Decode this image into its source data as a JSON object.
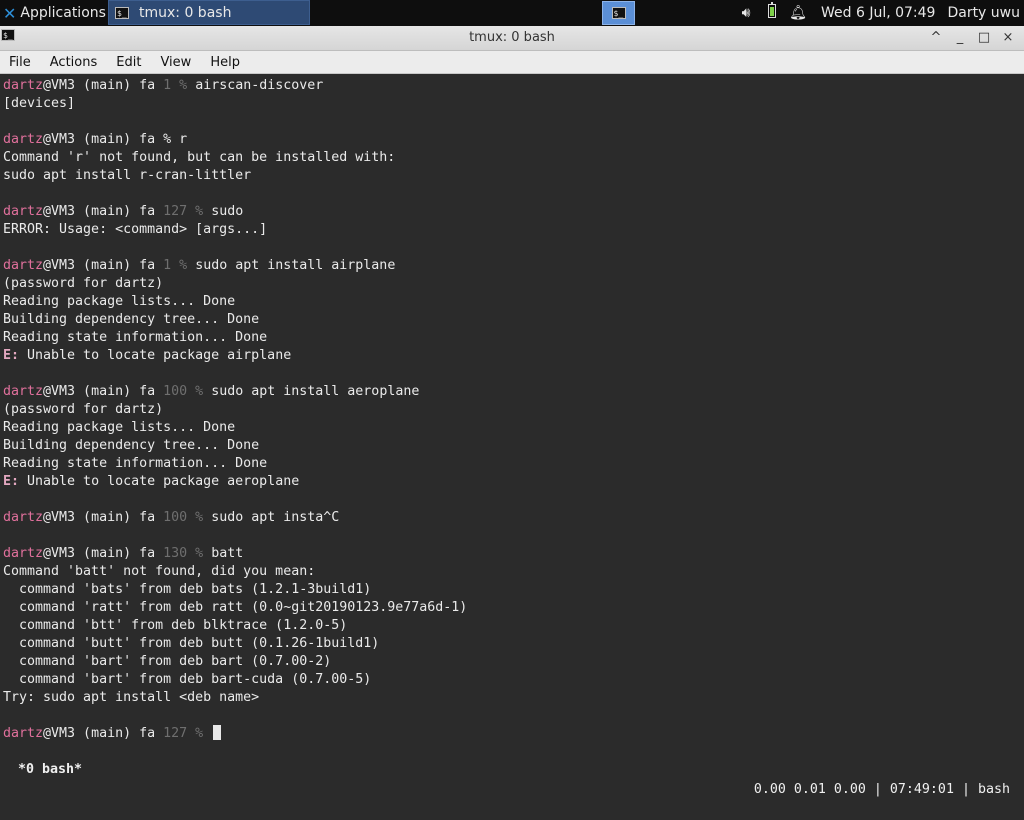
{
  "panel": {
    "applications_label": "Applications",
    "task_label": "tmux: 0 bash",
    "clock": "Wed  6 Jul, 07:49",
    "user": "Darty uwu",
    "icons": [
      "xfce-logo-icon",
      "terminal-icon",
      "volume-icon",
      "battery-icon",
      "notification-bell-icon"
    ]
  },
  "window": {
    "title": "tmux: 0 bash",
    "buttons": [
      "^",
      "_",
      "□",
      "×"
    ]
  },
  "menu": {
    "items": [
      "File",
      "Actions",
      "Edit",
      "View",
      "Help"
    ]
  },
  "terminal": {
    "lines": [
      {
        "type": "prompt",
        "user": "dartz",
        "host": "@VM3 (main) fa",
        "code": "1",
        "cmd": "airscan-discover"
      },
      {
        "type": "out",
        "text": "[devices]"
      },
      {
        "type": "blank"
      },
      {
        "type": "prompt",
        "user": "dartz",
        "host": "@VM3 (main) fa",
        "code": "",
        "cmd": "r"
      },
      {
        "type": "out",
        "text": "Command 'r' not found, but can be installed with:"
      },
      {
        "type": "out",
        "text": "sudo apt install r-cran-littler"
      },
      {
        "type": "blank"
      },
      {
        "type": "prompt",
        "user": "dartz",
        "host": "@VM3 (main) fa",
        "code": "127",
        "cmd": "sudo"
      },
      {
        "type": "out",
        "text": "ERROR: Usage: <command> [args...]"
      },
      {
        "type": "blank"
      },
      {
        "type": "prompt",
        "user": "dartz",
        "host": "@VM3 (main) fa",
        "code": "1",
        "cmd": "sudo apt install airplane"
      },
      {
        "type": "out",
        "text": "(password for dartz)"
      },
      {
        "type": "out",
        "text": "Reading package lists... Done"
      },
      {
        "type": "out",
        "text": "Building dependency tree... Done"
      },
      {
        "type": "out",
        "text": "Reading state information... Done"
      },
      {
        "type": "err",
        "prefix": "E:",
        "text": " Unable to locate package airplane"
      },
      {
        "type": "blank"
      },
      {
        "type": "prompt",
        "user": "dartz",
        "host": "@VM3 (main) fa",
        "code": "100",
        "cmd": "sudo apt install aeroplane"
      },
      {
        "type": "out",
        "text": "(password for dartz)"
      },
      {
        "type": "out",
        "text": "Reading package lists... Done"
      },
      {
        "type": "out",
        "text": "Building dependency tree... Done"
      },
      {
        "type": "out",
        "text": "Reading state information... Done"
      },
      {
        "type": "err",
        "prefix": "E:",
        "text": " Unable to locate package aeroplane"
      },
      {
        "type": "blank"
      },
      {
        "type": "prompt",
        "user": "dartz",
        "host": "@VM3 (main) fa",
        "code": "100",
        "cmd": "sudo apt insta^C"
      },
      {
        "type": "blank"
      },
      {
        "type": "prompt",
        "user": "dartz",
        "host": "@VM3 (main) fa",
        "code": "130",
        "cmd": "batt"
      },
      {
        "type": "out",
        "text": "Command 'batt' not found, did you mean:"
      },
      {
        "type": "out",
        "text": "  command 'bats' from deb bats (1.2.1-3build1)"
      },
      {
        "type": "out",
        "text": "  command 'ratt' from deb ratt (0.0~git20190123.9e77a6d-1)"
      },
      {
        "type": "out",
        "text": "  command 'btt' from deb blktrace (1.2.0-5)"
      },
      {
        "type": "out",
        "text": "  command 'butt' from deb butt (0.1.26-1build1)"
      },
      {
        "type": "out",
        "text": "  command 'bart' from deb bart (0.7.00-2)"
      },
      {
        "type": "out",
        "text": "  command 'bart' from deb bart-cuda (0.7.00-5)"
      },
      {
        "type": "out",
        "text": "Try: sudo apt install <deb name>"
      },
      {
        "type": "blank"
      },
      {
        "type": "prompt",
        "user": "dartz",
        "host": "@VM3 (main) fa",
        "code": "127",
        "cmd": "",
        "cursor": true
      }
    ],
    "status_left": " *0 bash*",
    "status_right": "0.00 0.01 0.00 | 07:49:01 | bash"
  }
}
